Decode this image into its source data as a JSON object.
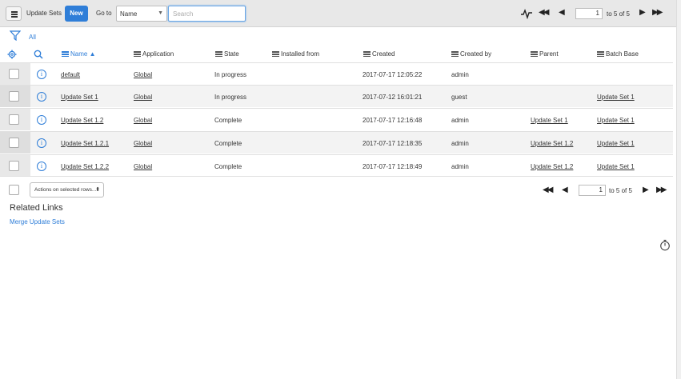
{
  "header": {
    "title": "Update Sets",
    "new_label": "New",
    "goto_label": "Go to",
    "search_field": "Name",
    "search_placeholder": "Search",
    "page_input": "1",
    "page_text": "to 5 of 5"
  },
  "filter": {
    "all_label": "All"
  },
  "columns": [
    {
      "label": "Name",
      "sorted": "asc"
    },
    {
      "label": "Application"
    },
    {
      "label": "State"
    },
    {
      "label": "Installed from"
    },
    {
      "label": "Created"
    },
    {
      "label": "Created by"
    },
    {
      "label": "Parent"
    },
    {
      "label": "Batch Base"
    }
  ],
  "rows": [
    {
      "name": "default",
      "application": "Global",
      "state": "In progress",
      "installed_from": "",
      "created": "2017-07-17 12:05:22",
      "created_by": "admin",
      "parent": "",
      "batch_base": ""
    },
    {
      "name": "Update Set 1",
      "application": "Global",
      "state": "In progress",
      "installed_from": "",
      "created": "2017-07-12 16:01:21",
      "created_by": "guest",
      "parent": "",
      "batch_base": "Update Set 1"
    },
    {
      "name": "Update Set 1.2",
      "application": "Global",
      "state": "Complete",
      "installed_from": "",
      "created": "2017-07-17 12:16:48",
      "created_by": "admin",
      "parent": "Update Set 1",
      "batch_base": "Update Set 1"
    },
    {
      "name": "Update Set 1.2.1",
      "application": "Global",
      "state": "Complete",
      "installed_from": "",
      "created": "2017-07-17 12:18:35",
      "created_by": "admin",
      "parent": "Update Set 1.2",
      "batch_base": "Update Set 1"
    },
    {
      "name": "Update Set 1.2.2",
      "application": "Global",
      "state": "Complete",
      "installed_from": "",
      "created": "2017-07-17 12:18:49",
      "created_by": "admin",
      "parent": "Update Set 1.2",
      "batch_base": "Update Set 1"
    }
  ],
  "footer": {
    "actions_label": "Actions on selected rows...",
    "page_input": "1",
    "page_text": "to 5 of 5"
  },
  "related": {
    "title": "Related Links",
    "links": [
      "Merge Update Sets"
    ]
  },
  "colors": {
    "accent": "#2f7ed8",
    "topbar": "#e8e8e8",
    "alt_row": "#f3f3f3"
  }
}
